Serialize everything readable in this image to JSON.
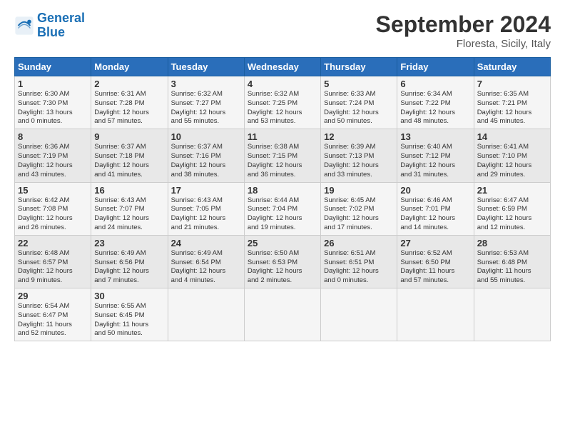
{
  "header": {
    "logo_line1": "General",
    "logo_line2": "Blue",
    "month_title": "September 2024",
    "location": "Floresta, Sicily, Italy"
  },
  "weekdays": [
    "Sunday",
    "Monday",
    "Tuesday",
    "Wednesday",
    "Thursday",
    "Friday",
    "Saturday"
  ],
  "weeks": [
    [
      {
        "day": "1",
        "sunrise": "6:30 AM",
        "sunset": "7:30 PM",
        "daylight": "13 hours and 0 minutes."
      },
      {
        "day": "2",
        "sunrise": "6:31 AM",
        "sunset": "7:28 PM",
        "daylight": "12 hours and 57 minutes."
      },
      {
        "day": "3",
        "sunrise": "6:32 AM",
        "sunset": "7:27 PM",
        "daylight": "12 hours and 55 minutes."
      },
      {
        "day": "4",
        "sunrise": "6:32 AM",
        "sunset": "7:25 PM",
        "daylight": "12 hours and 53 minutes."
      },
      {
        "day": "5",
        "sunrise": "6:33 AM",
        "sunset": "7:24 PM",
        "daylight": "12 hours and 50 minutes."
      },
      {
        "day": "6",
        "sunrise": "6:34 AM",
        "sunset": "7:22 PM",
        "daylight": "12 hours and 48 minutes."
      },
      {
        "day": "7",
        "sunrise": "6:35 AM",
        "sunset": "7:21 PM",
        "daylight": "12 hours and 45 minutes."
      }
    ],
    [
      {
        "day": "8",
        "sunrise": "6:36 AM",
        "sunset": "7:19 PM",
        "daylight": "12 hours and 43 minutes."
      },
      {
        "day": "9",
        "sunrise": "6:37 AM",
        "sunset": "7:18 PM",
        "daylight": "12 hours and 41 minutes."
      },
      {
        "day": "10",
        "sunrise": "6:37 AM",
        "sunset": "7:16 PM",
        "daylight": "12 hours and 38 minutes."
      },
      {
        "day": "11",
        "sunrise": "6:38 AM",
        "sunset": "7:15 PM",
        "daylight": "12 hours and 36 minutes."
      },
      {
        "day": "12",
        "sunrise": "6:39 AM",
        "sunset": "7:13 PM",
        "daylight": "12 hours and 33 minutes."
      },
      {
        "day": "13",
        "sunrise": "6:40 AM",
        "sunset": "7:12 PM",
        "daylight": "12 hours and 31 minutes."
      },
      {
        "day": "14",
        "sunrise": "6:41 AM",
        "sunset": "7:10 PM",
        "daylight": "12 hours and 29 minutes."
      }
    ],
    [
      {
        "day": "15",
        "sunrise": "6:42 AM",
        "sunset": "7:08 PM",
        "daylight": "12 hours and 26 minutes."
      },
      {
        "day": "16",
        "sunrise": "6:43 AM",
        "sunset": "7:07 PM",
        "daylight": "12 hours and 24 minutes."
      },
      {
        "day": "17",
        "sunrise": "6:43 AM",
        "sunset": "7:05 PM",
        "daylight": "12 hours and 21 minutes."
      },
      {
        "day": "18",
        "sunrise": "6:44 AM",
        "sunset": "7:04 PM",
        "daylight": "12 hours and 19 minutes."
      },
      {
        "day": "19",
        "sunrise": "6:45 AM",
        "sunset": "7:02 PM",
        "daylight": "12 hours and 17 minutes."
      },
      {
        "day": "20",
        "sunrise": "6:46 AM",
        "sunset": "7:01 PM",
        "daylight": "12 hours and 14 minutes."
      },
      {
        "day": "21",
        "sunrise": "6:47 AM",
        "sunset": "6:59 PM",
        "daylight": "12 hours and 12 minutes."
      }
    ],
    [
      {
        "day": "22",
        "sunrise": "6:48 AM",
        "sunset": "6:57 PM",
        "daylight": "12 hours and 9 minutes."
      },
      {
        "day": "23",
        "sunrise": "6:49 AM",
        "sunset": "6:56 PM",
        "daylight": "12 hours and 7 minutes."
      },
      {
        "day": "24",
        "sunrise": "6:49 AM",
        "sunset": "6:54 PM",
        "daylight": "12 hours and 4 minutes."
      },
      {
        "day": "25",
        "sunrise": "6:50 AM",
        "sunset": "6:53 PM",
        "daylight": "12 hours and 2 minutes."
      },
      {
        "day": "26",
        "sunrise": "6:51 AM",
        "sunset": "6:51 PM",
        "daylight": "12 hours and 0 minutes."
      },
      {
        "day": "27",
        "sunrise": "6:52 AM",
        "sunset": "6:50 PM",
        "daylight": "11 hours and 57 minutes."
      },
      {
        "day": "28",
        "sunrise": "6:53 AM",
        "sunset": "6:48 PM",
        "daylight": "11 hours and 55 minutes."
      }
    ],
    [
      {
        "day": "29",
        "sunrise": "6:54 AM",
        "sunset": "6:47 PM",
        "daylight": "11 hours and 52 minutes."
      },
      {
        "day": "30",
        "sunrise": "6:55 AM",
        "sunset": "6:45 PM",
        "daylight": "11 hours and 50 minutes."
      },
      null,
      null,
      null,
      null,
      null
    ]
  ]
}
